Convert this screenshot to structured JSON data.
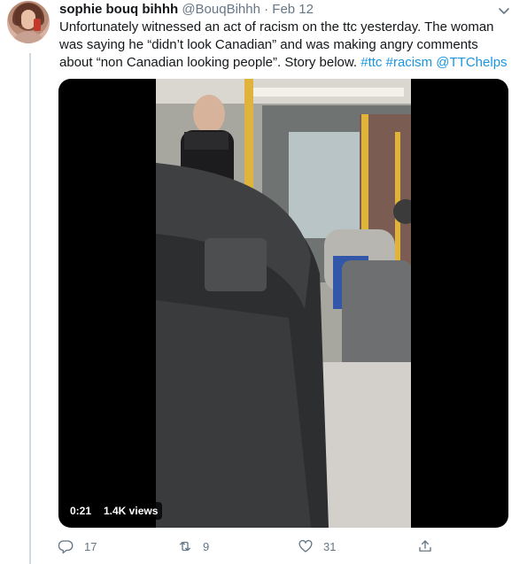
{
  "tweet": {
    "author_name": "sophie bouq bihhh",
    "author_handle": "@BouqBihhh",
    "separator": "·",
    "date": "Feb 12",
    "text_plain": "Unfortunately witnessed an act of racism on the ttc yesterday. The woman was saying he “didn’t look Canadian” and was making angry comments about “non Canadian looking people”. Story below.",
    "hashtags": [
      "#ttc",
      "#racism"
    ],
    "mention": "@TTChelps"
  },
  "video": {
    "duration": "0:21",
    "views": "1.4K views"
  },
  "actions": {
    "replies": "17",
    "retweets": "9",
    "likes": "31"
  },
  "icons": {
    "more": "chevron-down-icon",
    "reply": "reply-icon",
    "retweet": "retweet-icon",
    "like": "heart-icon",
    "share": "share-icon"
  },
  "colors": {
    "link": "#1b95e0",
    "secondary_text": "#657786",
    "primary_text": "#14171a"
  }
}
